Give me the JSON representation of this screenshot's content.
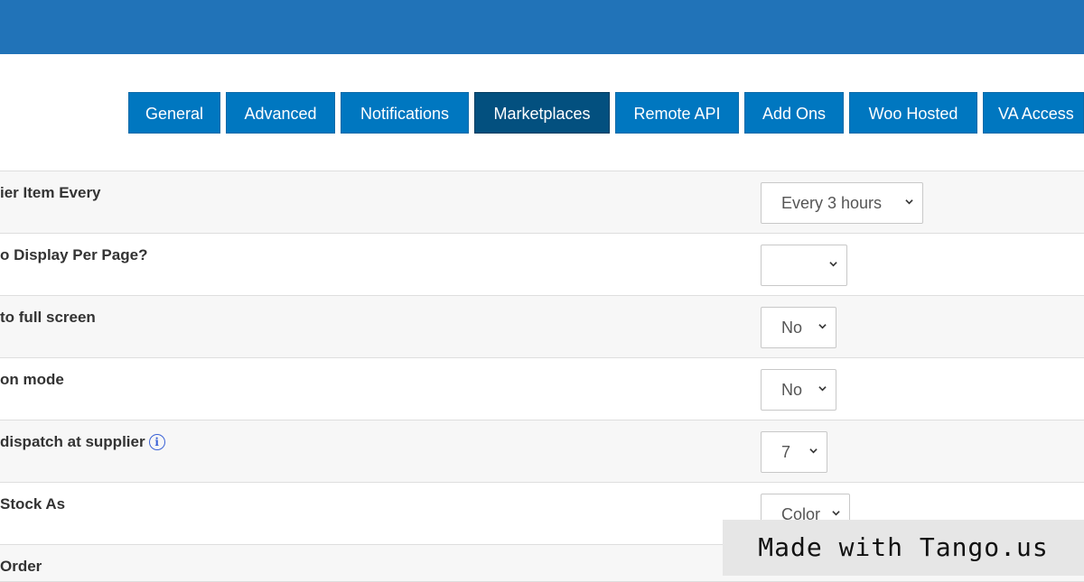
{
  "header": {
    "color": "#2173b8"
  },
  "tabs": [
    {
      "label": "General",
      "active": false
    },
    {
      "label": "Advanced",
      "active": false
    },
    {
      "label": "Notifications",
      "active": false
    },
    {
      "label": "Marketplaces",
      "active": true
    },
    {
      "label": "Remote API",
      "active": false
    },
    {
      "label": "Add Ons",
      "active": false
    },
    {
      "label": "Woo Hosted",
      "active": false
    },
    {
      "label": "VA Access",
      "active": false
    }
  ],
  "settings": [
    {
      "label": "ier Item Every",
      "value": "Every 3 hours"
    },
    {
      "label": "o Display Per Page?",
      "value": ""
    },
    {
      "label": "to full screen",
      "value": "No"
    },
    {
      "label": "on mode",
      "value": "No"
    },
    {
      "label": "dispatch at supplier",
      "value": "7",
      "info_icon": "info-icon"
    },
    {
      "label": "Stock As",
      "value": "Color"
    },
    {
      "label": "Order",
      "value": ""
    }
  ],
  "watermark": {
    "text": "Made with Tango.us"
  },
  "colors": {
    "tab": "#0077c0",
    "tab_active": "#03507f",
    "info": "#3b62d6"
  }
}
